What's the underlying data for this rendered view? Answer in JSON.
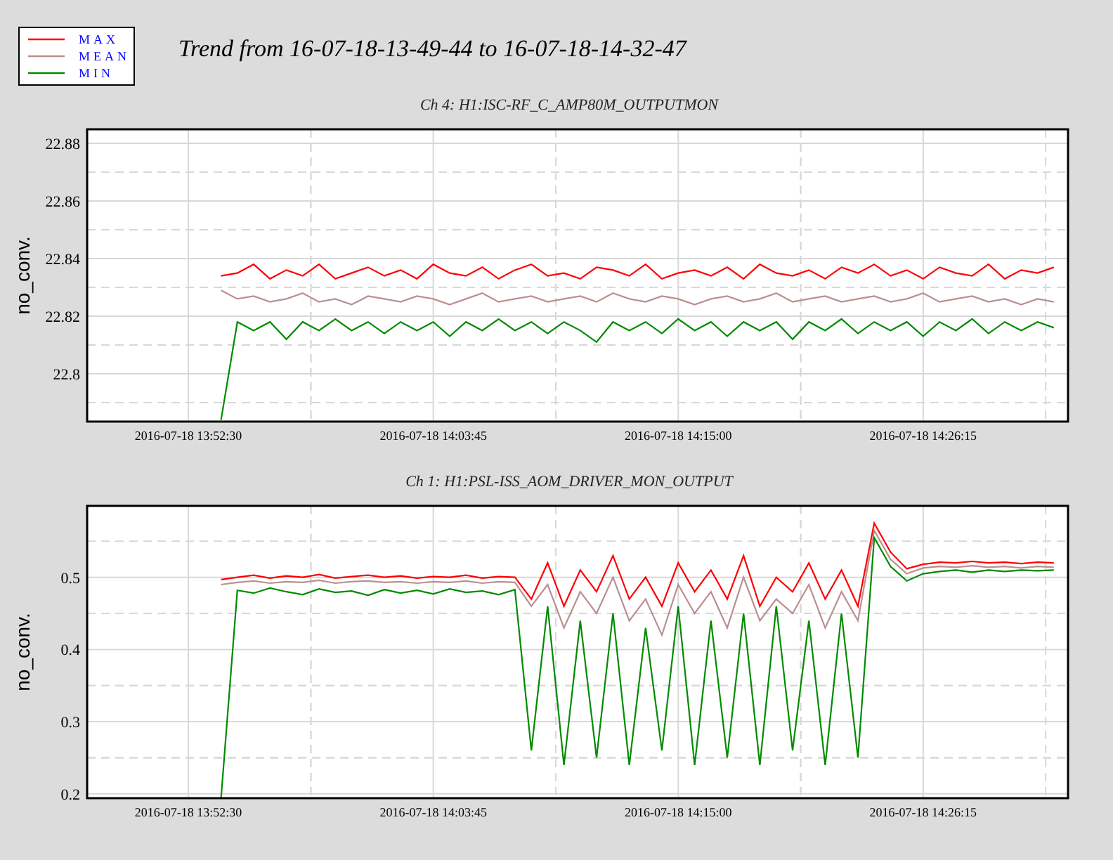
{
  "legend": [
    {
      "label": "MAX",
      "color": "#ff0000"
    },
    {
      "label": "MEAN",
      "color": "#bc8f8f"
    },
    {
      "label": "MIN",
      "color": "#008b00"
    }
  ],
  "title": "Trend from 16-07-18-13-49-44 to 16-07-18-14-32-47",
  "charts": [
    {
      "chart_data": {
        "type": "line",
        "grid": true,
        "title": "Ch 4: H1:ISC-RF_C_AMP80M_OUTPUTMON",
        "ylabel": "no_conv.",
        "categories": [
          null,
          null,
          null,
          null,
          null,
          null,
          "2016-07-18 13:52:30",
          null,
          null,
          null,
          null,
          null,
          null,
          null,
          null,
          null,
          null,
          null,
          null,
          null,
          null,
          "2016-07-18 14:03:45",
          null,
          null,
          null,
          null,
          null,
          null,
          null,
          null,
          null,
          null,
          null,
          null,
          null,
          null,
          "2016-07-18 14:15:00",
          null,
          null,
          null,
          null,
          null,
          null,
          null,
          null,
          null,
          null,
          null,
          null,
          null,
          null,
          "2016-07-18 14:26:15",
          null,
          null,
          null,
          null,
          null,
          null,
          null,
          null
        ],
        "ylim": [
          22.7834,
          22.8849
        ],
        "yticks": [
          {
            "value": 22.8,
            "label": "22.8"
          },
          {
            "value": 22.82,
            "label": "22.82"
          },
          {
            "value": 22.84,
            "label": "22.84"
          },
          {
            "value": 22.86,
            "label": "22.86"
          },
          {
            "value": 22.88,
            "label": "22.88"
          }
        ],
        "series": [
          {
            "color": "#ff0000",
            "values": [
              null,
              null,
              null,
              null,
              null,
              null,
              null,
              null,
              22.834,
              22.835,
              22.838,
              22.833,
              22.836,
              22.834,
              22.838,
              22.833,
              22.835,
              22.837,
              22.834,
              22.836,
              22.833,
              22.838,
              22.835,
              22.834,
              22.837,
              22.833,
              22.836,
              22.838,
              22.834,
              22.835,
              22.833,
              22.837,
              22.836,
              22.834,
              22.838,
              22.833,
              22.835,
              22.836,
              22.834,
              22.837,
              22.833,
              22.838,
              22.835,
              22.834,
              22.836,
              22.833,
              22.837,
              22.835,
              22.838,
              22.834,
              22.836,
              22.833,
              22.837,
              22.835,
              22.834,
              22.838,
              22.833,
              22.836,
              22.835,
              22.837
            ]
          },
          {
            "color": "#bc8f8f",
            "values": [
              null,
              null,
              null,
              null,
              null,
              null,
              null,
              null,
              22.829,
              22.826,
              22.827,
              22.825,
              22.826,
              22.828,
              22.825,
              22.826,
              22.824,
              22.827,
              22.826,
              22.825,
              22.827,
              22.826,
              22.824,
              22.826,
              22.828,
              22.825,
              22.826,
              22.827,
              22.825,
              22.826,
              22.827,
              22.825,
              22.828,
              22.826,
              22.825,
              22.827,
              22.826,
              22.824,
              22.826,
              22.827,
              22.825,
              22.826,
              22.828,
              22.825,
              22.826,
              22.827,
              22.825,
              22.826,
              22.827,
              22.825,
              22.826,
              22.828,
              22.825,
              22.826,
              22.827,
              22.825,
              22.826,
              22.824,
              22.826,
              22.825
            ]
          },
          {
            "color": "#008b00",
            "values": [
              null,
              null,
              null,
              null,
              null,
              null,
              null,
              null,
              22.784,
              22.818,
              22.815,
              22.818,
              22.812,
              22.818,
              22.815,
              22.819,
              22.815,
              22.818,
              22.814,
              22.818,
              22.815,
              22.818,
              22.813,
              22.818,
              22.815,
              22.819,
              22.815,
              22.818,
              22.814,
              22.818,
              22.815,
              22.811,
              22.818,
              22.815,
              22.818,
              22.814,
              22.819,
              22.815,
              22.818,
              22.813,
              22.818,
              22.815,
              22.818,
              22.812,
              22.818,
              22.815,
              22.819,
              22.814,
              22.818,
              22.815,
              22.818,
              22.813,
              22.818,
              22.815,
              22.819,
              22.814,
              22.818,
              22.815,
              22.818,
              22.816
            ]
          }
        ]
      }
    },
    {
      "chart_data": {
        "type": "line",
        "grid": true,
        "title": "Ch 1: H1:PSL-ISS_AOM_DRIVER_MON_OUTPUT",
        "ylabel": "no_conv.",
        "categories": [
          null,
          null,
          null,
          null,
          null,
          null,
          "2016-07-18 13:52:30",
          null,
          null,
          null,
          null,
          null,
          null,
          null,
          null,
          null,
          null,
          null,
          null,
          null,
          null,
          "2016-07-18 14:03:45",
          null,
          null,
          null,
          null,
          null,
          null,
          null,
          null,
          null,
          null,
          null,
          null,
          null,
          null,
          "2016-07-18 14:15:00",
          null,
          null,
          null,
          null,
          null,
          null,
          null,
          null,
          null,
          null,
          null,
          null,
          null,
          null,
          "2016-07-18 14:26:15",
          null,
          null,
          null,
          null,
          null,
          null,
          null,
          null
        ],
        "ylim": [
          0.194,
          0.599
        ],
        "yticks": [
          {
            "value": 0.2,
            "label": "0.2"
          },
          {
            "value": 0.3,
            "label": "0.3"
          },
          {
            "value": 0.4,
            "label": "0.4"
          },
          {
            "value": 0.5,
            "label": "0.5"
          }
        ],
        "series": [
          {
            "color": "#ff0000",
            "values": [
              null,
              null,
              null,
              null,
              null,
              null,
              null,
              null,
              0.497,
              0.5,
              0.503,
              0.499,
              0.502,
              0.5,
              0.504,
              0.499,
              0.501,
              0.503,
              0.5,
              0.502,
              0.499,
              0.501,
              0.5,
              0.503,
              0.499,
              0.501,
              0.5,
              0.47,
              0.52,
              0.46,
              0.51,
              0.48,
              0.53,
              0.47,
              0.5,
              0.46,
              0.52,
              0.48,
              0.51,
              0.47,
              0.53,
              0.46,
              0.5,
              0.48,
              0.52,
              0.47,
              0.51,
              0.46,
              0.575,
              0.535,
              0.512,
              0.518,
              0.521,
              0.52,
              0.522,
              0.52,
              0.521,
              0.519,
              0.521,
              0.52
            ]
          },
          {
            "color": "#bc8f8f",
            "values": [
              null,
              null,
              null,
              null,
              null,
              null,
              null,
              null,
              0.49,
              0.493,
              0.495,
              0.492,
              0.494,
              0.493,
              0.496,
              0.492,
              0.494,
              0.495,
              0.493,
              0.494,
              0.492,
              0.494,
              0.493,
              0.495,
              0.492,
              0.494,
              0.493,
              0.46,
              0.49,
              0.43,
              0.48,
              0.45,
              0.5,
              0.44,
              0.47,
              0.42,
              0.49,
              0.45,
              0.48,
              0.43,
              0.5,
              0.44,
              0.47,
              0.45,
              0.49,
              0.43,
              0.48,
              0.44,
              0.565,
              0.525,
              0.505,
              0.513,
              0.515,
              0.514,
              0.516,
              0.514,
              0.515,
              0.513,
              0.515,
              0.514
            ]
          },
          {
            "color": "#008b00",
            "values": [
              null,
              null,
              null,
              null,
              null,
              null,
              null,
              null,
              0.194,
              0.482,
              0.478,
              0.485,
              0.48,
              0.476,
              0.484,
              0.479,
              0.481,
              0.475,
              0.483,
              0.478,
              0.482,
              0.477,
              0.484,
              0.479,
              0.481,
              0.476,
              0.483,
              0.26,
              0.46,
              0.24,
              0.44,
              0.25,
              0.45,
              0.24,
              0.43,
              0.26,
              0.46,
              0.24,
              0.44,
              0.25,
              0.45,
              0.24,
              0.46,
              0.26,
              0.44,
              0.24,
              0.45,
              0.25,
              0.555,
              0.515,
              0.495,
              0.505,
              0.508,
              0.51,
              0.507,
              0.51,
              0.508,
              0.51,
              0.509,
              0.51
            ]
          }
        ]
      }
    }
  ]
}
